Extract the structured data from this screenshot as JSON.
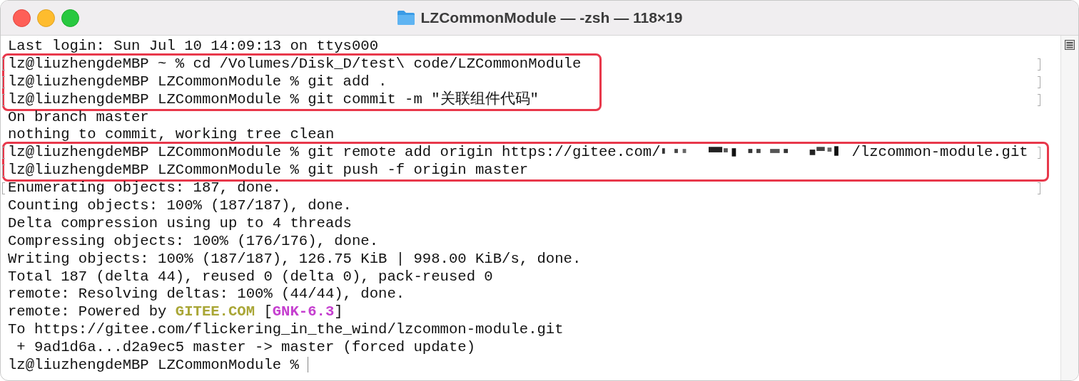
{
  "window": {
    "title": "LZCommonModule — -zsh — 118×19"
  },
  "blocks": [
    {
      "highlighted": false,
      "lines": [
        {
          "segments": [
            {
              "kind": "text",
              "text": "Last login: Sun Jul 10 14:09:13 on ttys000"
            }
          ]
        }
      ]
    },
    {
      "highlighted": true,
      "lines": [
        {
          "mark_start": true,
          "mark_end": true,
          "segments": [
            {
              "kind": "text",
              "text": "lz@liuzhengdeMBP ~ % cd /Volumes/Disk_D/test\\ code/LZCommonModule"
            }
          ]
        },
        {
          "mark_start": true,
          "mark_end": true,
          "segments": [
            {
              "kind": "text",
              "text": "lz@liuzhengdeMBP LZCommonModule % git add ."
            }
          ]
        },
        {
          "mark_start": true,
          "mark_end": true,
          "segments": [
            {
              "kind": "text",
              "text": "lz@liuzhengdeMBP LZCommonModule % git commit -m \"关联组件代码\""
            }
          ]
        }
      ]
    },
    {
      "highlighted": false,
      "lines": [
        {
          "segments": [
            {
              "kind": "text",
              "text": "On branch master"
            }
          ]
        },
        {
          "segments": [
            {
              "kind": "text",
              "text": "nothing to commit, working tree clean"
            }
          ]
        }
      ]
    },
    {
      "highlighted": true,
      "lines": [
        {
          "mark_start": true,
          "mark_end": true,
          "segments": [
            {
              "kind": "text",
              "text": "lz@liuzhengdeMBP LZCommonModule % git remote add origin https://gitee.com/"
            },
            {
              "kind": "redacted"
            },
            {
              "kind": "text",
              "text": "/lzcommon-module.git"
            }
          ]
        },
        {
          "mark_start": true,
          "mark_end": false,
          "segments": [
            {
              "kind": "text",
              "text": "lz@liuzhengdeMBP LZCommonModule % git push -f origin master"
            }
          ]
        }
      ]
    },
    {
      "highlighted": false,
      "lines": [
        {
          "mark_start": true,
          "mark_end": true,
          "segments": [
            {
              "kind": "text",
              "text": "Enumerating objects: 187, done."
            }
          ]
        },
        {
          "segments": [
            {
              "kind": "text",
              "text": "Counting objects: 100% (187/187), done."
            }
          ]
        },
        {
          "segments": [
            {
              "kind": "text",
              "text": "Delta compression using up to 4 threads"
            }
          ]
        },
        {
          "segments": [
            {
              "kind": "text",
              "text": "Compressing objects: 100% (176/176), done."
            }
          ]
        },
        {
          "segments": [
            {
              "kind": "text",
              "text": "Writing objects: 100% (187/187), 126.75 KiB | 998.00 KiB/s, done."
            }
          ]
        },
        {
          "segments": [
            {
              "kind": "text",
              "text": "Total 187 (delta 44), reused 0 (delta 0), pack-reused 0"
            }
          ]
        },
        {
          "segments": [
            {
              "kind": "text",
              "text": "remote: Resolving deltas: 100% (44/44), done."
            }
          ]
        },
        {
          "segments": [
            {
              "kind": "text",
              "text": "remote: Powered by "
            },
            {
              "kind": "text",
              "text": "GITEE.COM",
              "color": "#a9a636"
            },
            {
              "kind": "text",
              "text": " ["
            },
            {
              "kind": "text",
              "text": "GNK-6.3",
              "color": "#c53fcf"
            },
            {
              "kind": "text",
              "text": "]"
            }
          ]
        },
        {
          "segments": [
            {
              "kind": "text",
              "text": "To https://gitee.com/flickering_in_the_wind/lzcommon-module.git"
            }
          ]
        },
        {
          "segments": [
            {
              "kind": "text",
              "text": " + 9ad1d6a...d2a9ec5 master -> master (forced update)"
            }
          ]
        },
        {
          "cursor": true,
          "segments": [
            {
              "kind": "text",
              "text": "lz@liuzhengdeMBP LZCommonModule % "
            }
          ]
        }
      ]
    }
  ]
}
